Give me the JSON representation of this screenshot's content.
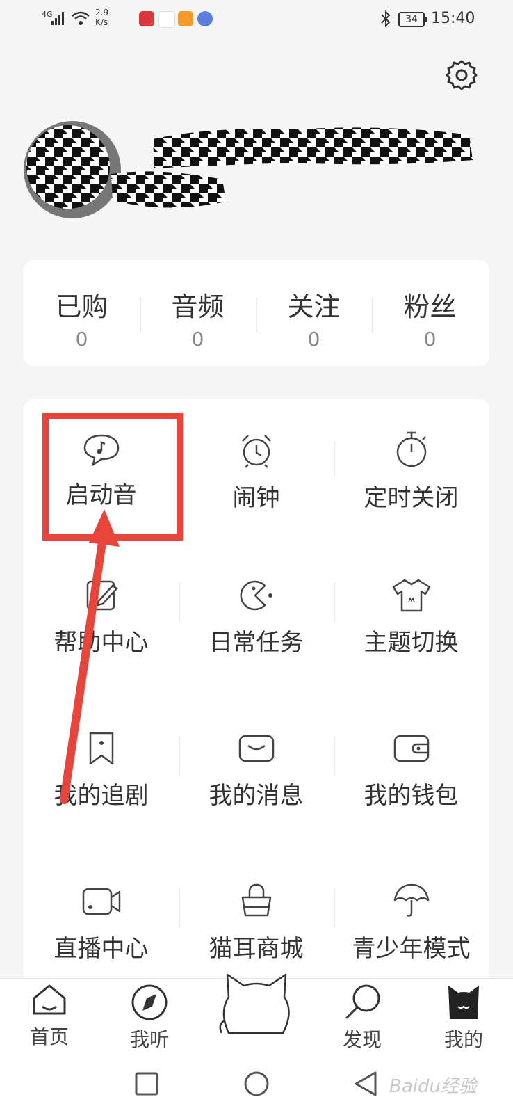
{
  "status_bar": {
    "network": "4G",
    "speed_value": "2.9",
    "speed_unit": "K/s",
    "battery": "34",
    "time": "15:40"
  },
  "stats": [
    {
      "label": "已购",
      "value": "0"
    },
    {
      "label": "音频",
      "value": "0"
    },
    {
      "label": "关注",
      "value": "0"
    },
    {
      "label": "粉丝",
      "value": "0"
    }
  ],
  "grid": [
    {
      "label": "启动音",
      "icon": "speech-note-icon"
    },
    {
      "label": "闹钟",
      "icon": "alarm-clock-icon"
    },
    {
      "label": "定时关闭",
      "icon": "stopwatch-icon"
    },
    {
      "label": "帮助中心",
      "icon": "help-edit-icon"
    },
    {
      "label": "日常任务",
      "icon": "pacman-icon"
    },
    {
      "label": "主题切换",
      "icon": "tshirt-icon"
    },
    {
      "label": "我的追剧",
      "icon": "bookmark-icon"
    },
    {
      "label": "我的消息",
      "icon": "message-icon"
    },
    {
      "label": "我的钱包",
      "icon": "wallet-icon"
    },
    {
      "label": "直播中心",
      "icon": "video-camera-icon"
    },
    {
      "label": "猫耳商城",
      "icon": "shopping-bag-icon"
    },
    {
      "label": "青少年模式",
      "icon": "umbrella-icon"
    }
  ],
  "bottom_nav": [
    {
      "label": "首页",
      "icon": "home-icon"
    },
    {
      "label": "我听",
      "icon": "compass-icon"
    },
    {
      "label": "",
      "icon": "cat-icon"
    },
    {
      "label": "发现",
      "icon": "magnifier-icon"
    },
    {
      "label": "我的",
      "icon": "cat-avatar-icon"
    }
  ],
  "watermark": "Baidu经验",
  "colors": {
    "highlight": "#e8443a",
    "background": "#f5f5f5",
    "card": "#ffffff"
  }
}
